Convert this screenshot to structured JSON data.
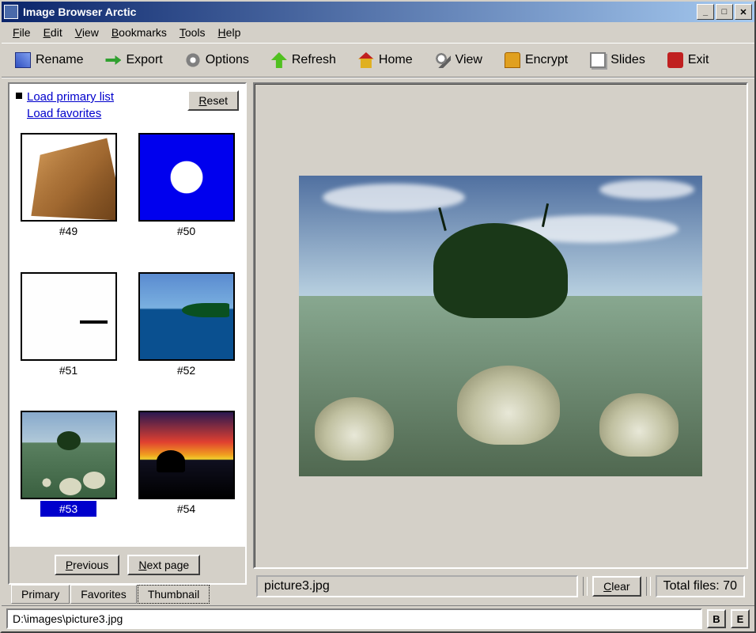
{
  "window": {
    "title": "Image Browser Arctic"
  },
  "menu": {
    "file": "File",
    "edit": "Edit",
    "view": "View",
    "bookmarks": "Bookmarks",
    "tools": "Tools",
    "help": "Help"
  },
  "toolbar": {
    "rename": "Rename",
    "export": "Export",
    "options": "Options",
    "refresh": "Refresh",
    "home": "Home",
    "view": "View",
    "encrypt": "Encrypt",
    "slides": "Slides",
    "exit": "Exit"
  },
  "sidebar": {
    "load_primary": "Load primary list",
    "load_favorites": "Load favorites",
    "reset": "Reset",
    "previous": "Previous",
    "next": "Next page",
    "tabs": {
      "primary": "Primary",
      "favorites": "Favorites",
      "thumbnail": "Thumbnail"
    },
    "thumbs": [
      {
        "id": "t49",
        "label": "#49"
      },
      {
        "id": "t50",
        "label": "#50"
      },
      {
        "id": "t51",
        "label": "#51"
      },
      {
        "id": "t52",
        "label": "#52"
      },
      {
        "id": "t53",
        "label": "#53",
        "selected": true
      },
      {
        "id": "t54",
        "label": "#54"
      }
    ]
  },
  "preview": {
    "filename": "picture3.jpg",
    "clear": "Clear",
    "total_label": "Total files:  70"
  },
  "status": {
    "path": "D:\\images\\picture3.jpg",
    "btn_b": "B",
    "btn_e": "E"
  }
}
